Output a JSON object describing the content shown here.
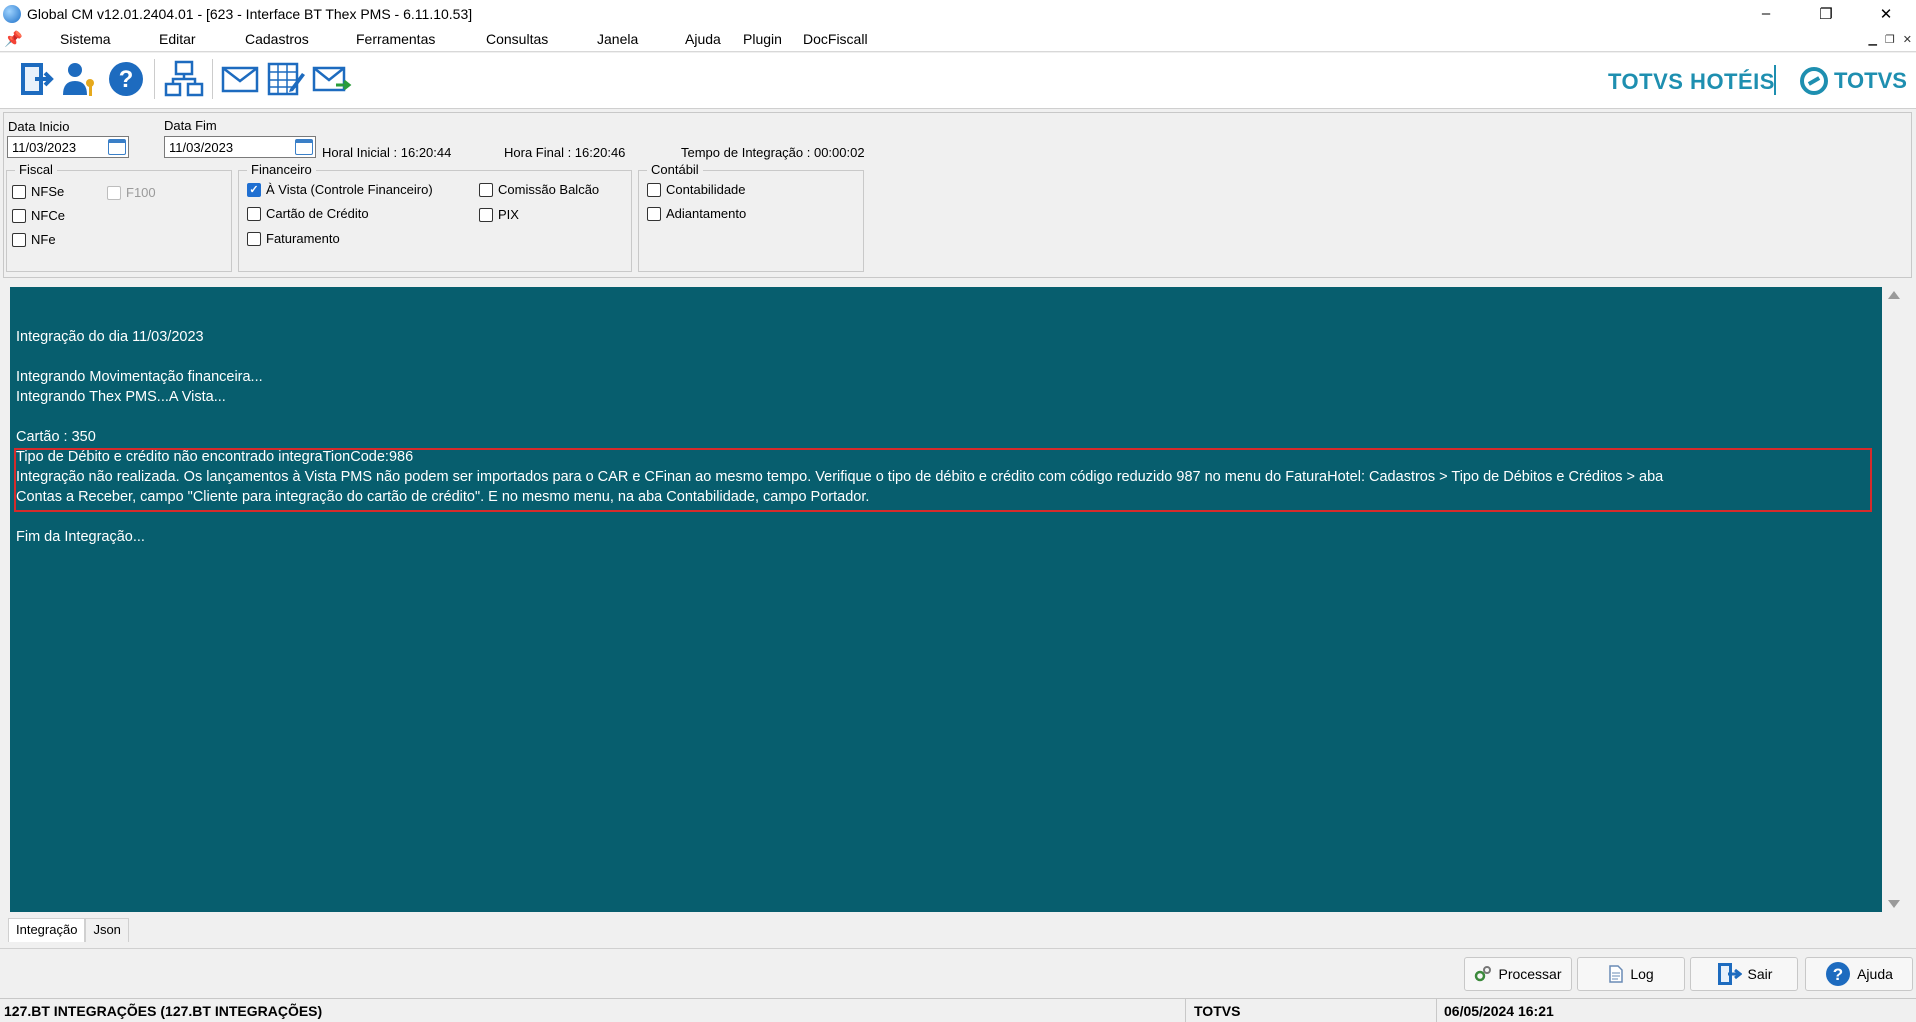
{
  "window": {
    "title": "Global CM v12.01.2404.01 - [623 - Interface BT Thex PMS - 6.11.10.53]",
    "controls": [
      "–",
      "❐",
      "✕"
    ]
  },
  "menu": {
    "items": [
      "Sistema",
      "Editar",
      "Cadastros",
      "Ferramentas",
      "Consultas",
      "Janela",
      "Ajuda",
      "Plugin",
      "DocFiscall"
    ]
  },
  "brand": {
    "left": "TOTVS HOTÉIS",
    "right": "TOTVS",
    "color": "#1e8fb0"
  },
  "filters": {
    "data_inicio_label": "Data Inicio",
    "data_inicio": "11/03/2023",
    "data_fim_label": "Data Fim",
    "data_fim": "11/03/2023",
    "hora_inicial": "Horal Inicial : 16:20:44",
    "hora_final": "Hora Final : 16:20:46",
    "tempo_integracao": "Tempo de Integração :  00:00:02"
  },
  "groups": {
    "fiscal": {
      "title": "Fiscal",
      "options": [
        {
          "label": "NFSe",
          "checked": false
        },
        {
          "label": "NFCe",
          "checked": false
        },
        {
          "label": "NFe",
          "checked": false
        },
        {
          "label": "F100",
          "checked": false,
          "disabled": true
        }
      ]
    },
    "financeiro": {
      "title": "Financeiro",
      "options": [
        {
          "label": "À Vista (Controle Financeiro)",
          "checked": true
        },
        {
          "label": "Cartão de Crédito",
          "checked": false
        },
        {
          "label": "Faturamento",
          "checked": false
        },
        {
          "label": "Comissão Balcão",
          "checked": false
        },
        {
          "label": "PIX",
          "checked": false
        }
      ]
    },
    "contabil": {
      "title": "Contábil",
      "options": [
        {
          "label": "Contabilidade",
          "checked": false
        },
        {
          "label": "Adiantamento",
          "checked": false
        }
      ]
    }
  },
  "log": {
    "background": "#075e6e",
    "lines": [
      "Integração do dia 11/03/2023",
      "Integrando Movimentação financeira...",
      "Integrando Thex PMS...A Vista...",
      "Cartão : 350",
      "Tipo de Débito e crédito não encontrado  integraTionCode:986",
      "Integração não realizada. Os lançamentos à Vista PMS não podem ser importados para o CAR e CFinan ao mesmo tempo. Verifique o tipo de débito e crédito com código reduzido 987 no menu do FaturaHotel: Cadastros > Tipo de Débitos e Créditos > aba",
      "Contas a Receber, campo \"Cliente para integração do cartão de crédito\". E no mesmo menu, na aba Contabilidade, campo Portador.",
      "Fim da Integração..."
    ],
    "error_highlight_color": "#d52b2b"
  },
  "tabs": [
    "Integração",
    "Json"
  ],
  "actions": {
    "processar": "Processar",
    "log": "Log",
    "sair": "Sair",
    "ajuda": "Ajuda"
  },
  "status": {
    "left": "127.BT INTEGRAÇÕES (127.BT INTEGRAÇÕES)",
    "center": "TOTVS",
    "right": "06/05/2024 16:21"
  }
}
